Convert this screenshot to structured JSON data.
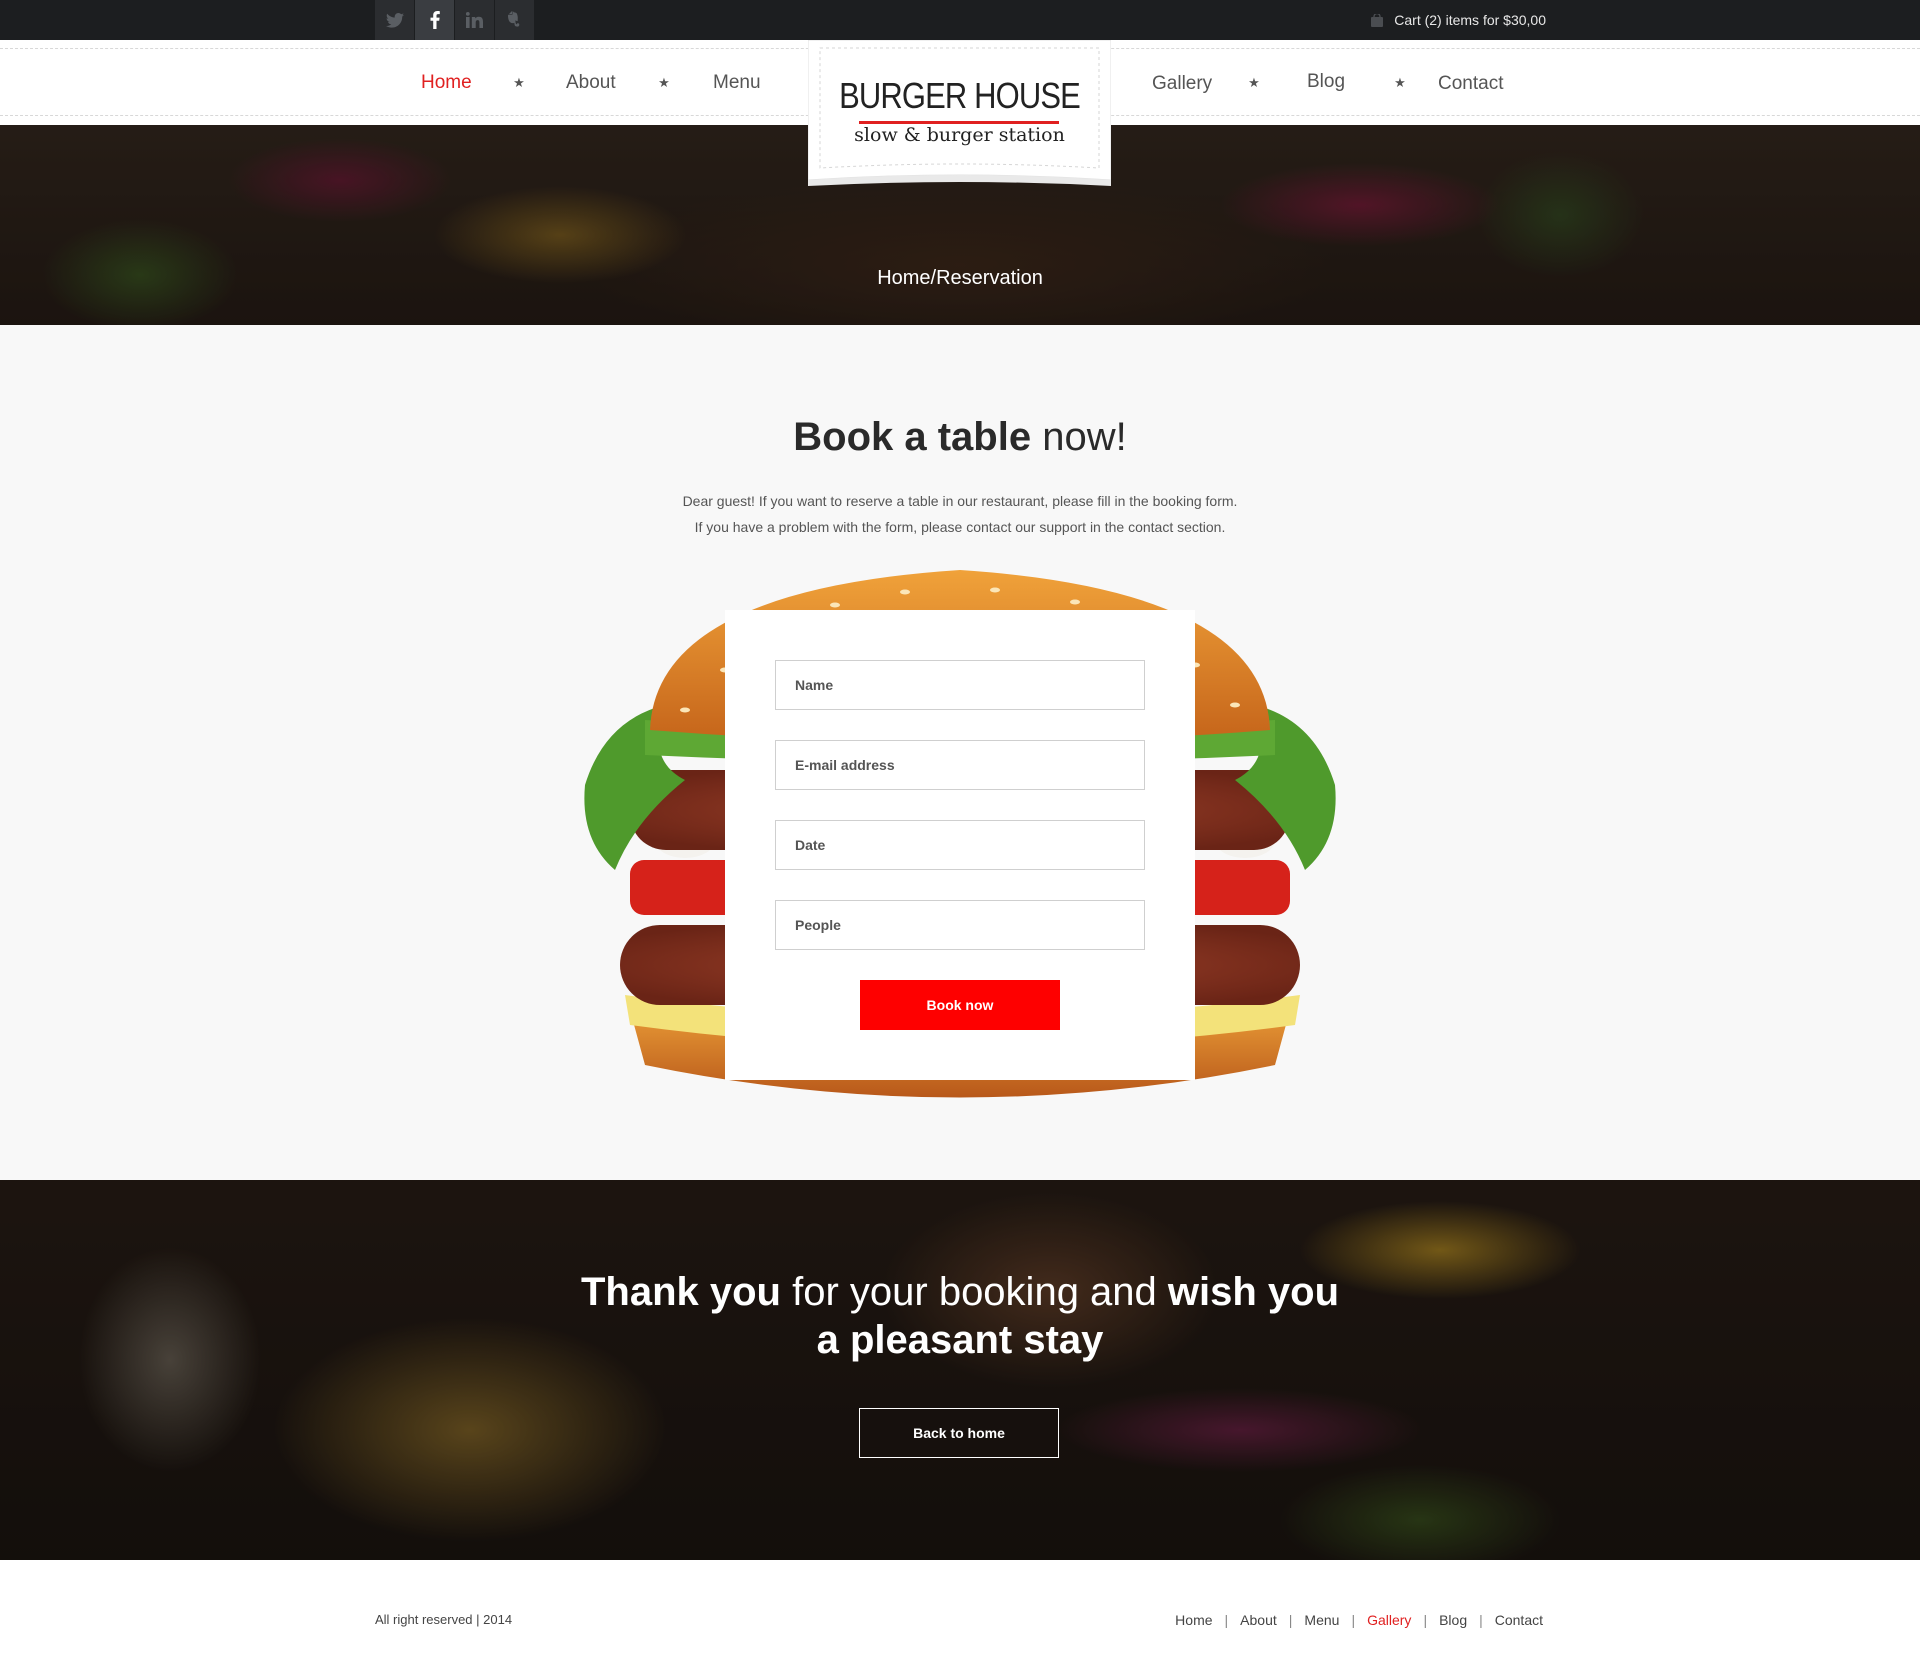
{
  "topbar": {
    "social": [
      {
        "icon": "twitter-icon"
      },
      {
        "icon": "facebook-icon"
      },
      {
        "icon": "linkedin-icon"
      },
      {
        "icon": "evernote-icon"
      }
    ],
    "cart_label": "Cart (2) items for $30,00"
  },
  "nav": {
    "left": [
      "Home",
      "About",
      "Menu"
    ],
    "right": [
      "Gallery",
      "Blog",
      "Contact"
    ],
    "active": "Home"
  },
  "logo": {
    "title": "BURGER HOUSE",
    "subtitle": "slow & burger station"
  },
  "hero": {
    "breadcrumb": "Home/Reservation"
  },
  "booking": {
    "title_bold": "Book a table",
    "title_light": " now!",
    "intro_line1": "Dear guest! If you want to reserve a table in our restaurant, please fill in the booking form.",
    "intro_line2": "If you have a problem with the form, please contact our support in the contact section.",
    "fields": {
      "name": "Name",
      "email": "E-mail address",
      "date": "Date",
      "people": "People"
    },
    "button": "Book now"
  },
  "thanks": {
    "part1": "Thank you",
    "part2": " for your booking and ",
    "part3": "wish you",
    "part4": "a pleasant stay",
    "button": "Back to home"
  },
  "footer": {
    "copyright": "All right reserved | 2014",
    "links": [
      "Home",
      "About",
      "Menu",
      "Gallery",
      "Blog",
      "Contact"
    ],
    "active": "Gallery"
  },
  "colors": {
    "accent": "#fe0000",
    "dark": "#1c1e20",
    "text": "#2a2a2a"
  }
}
